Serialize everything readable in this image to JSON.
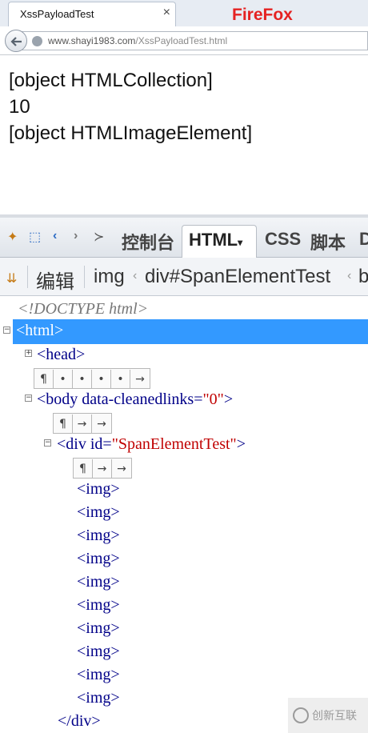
{
  "browser": {
    "tab_title": "XssPayloadTest",
    "close_glyph": "×",
    "firefox_label": "FireFox",
    "url_host": "www.shayi1983.com",
    "url_path": "/XssPayloadTest.html"
  },
  "page": {
    "lines": [
      "[object HTMLCollection]",
      "10",
      "[object HTMLImageElement]"
    ]
  },
  "firebug": {
    "toolbar_icons": [
      "inspect-icon",
      "pointer-icon",
      "back-icon",
      "forward-icon",
      "command-line-icon"
    ],
    "tabs": {
      "console": "控制台",
      "html": "HTML",
      "html_arrow": "▾",
      "css": "CSS",
      "script": "脚本",
      "dom": "D"
    },
    "crumb_icon": "edit-icon",
    "edit_label": "编辑",
    "breadcrumbs": [
      "img",
      "div#SpanElementTest",
      "b"
    ],
    "tree": {
      "doctype": "<!DOCTYPE html>",
      "html_open": "<html>",
      "head_open": "<head>",
      "body_open": "<body ",
      "body_attr": "data-cleanedlinks=",
      "body_val": "\"0\"",
      "gt": ">",
      "div_open": "<div ",
      "div_attr": "id=",
      "div_val": "\"SpanElementTest\"",
      "img": "<img>",
      "div_close": "</div>"
    },
    "whitespace": {
      "after_head": [
        "¶",
        "•",
        "•",
        "•",
        "•",
        "→"
      ],
      "after_body": [
        "¶",
        "→",
        "→"
      ],
      "after_div": [
        "¶",
        "→",
        "→"
      ]
    }
  },
  "watermark": {
    "text": "创新互联"
  }
}
